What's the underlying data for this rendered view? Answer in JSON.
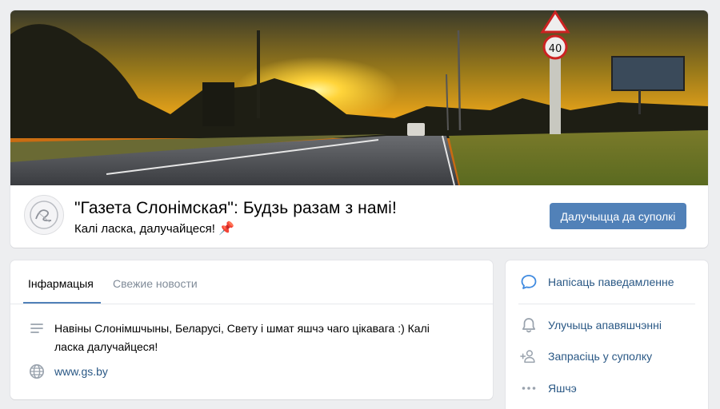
{
  "group": {
    "title": "\"Газета Слонімская\": Будзь разам з намі!",
    "status": "Калі ласка, далучайцеся!",
    "status_emoji": "pushpin-icon",
    "join_label": "Далучыцца да суполкі",
    "accent_color": "#5181b8",
    "link_color": "#2a5885"
  },
  "tabs": [
    {
      "label": "Інфармацыя",
      "active": true
    },
    {
      "label": "Свежие новости",
      "active": false
    }
  ],
  "info": {
    "description": "Навіны Слонімшчыны, Беларусі, Свету і шмат яшчэ чаго цікавага :) Калі ласка далучайцеся!",
    "website": "www.gs.by"
  },
  "actions": [
    {
      "label": "Напісаць паведамленне",
      "icon": "message-icon"
    },
    {
      "label": "Улучыць апавяшчэнні",
      "icon": "bell-icon"
    },
    {
      "label": "Запрасіць у суполку",
      "icon": "add-user-icon"
    },
    {
      "label": "Яшчэ",
      "icon": "more-icon"
    }
  ]
}
